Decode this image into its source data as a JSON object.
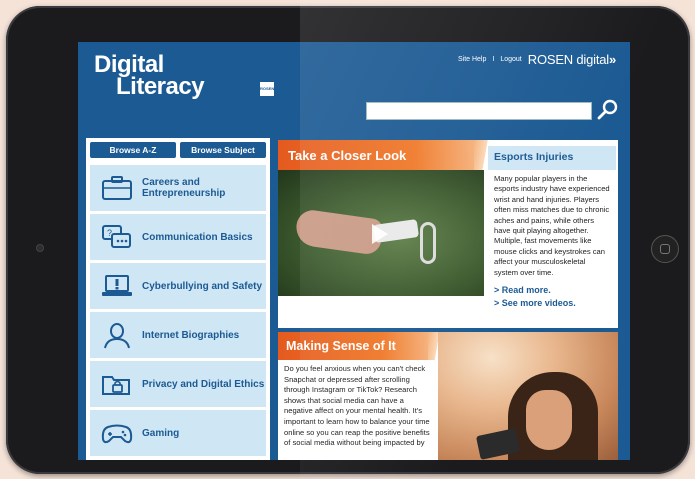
{
  "header": {
    "logo_line1": "Digital",
    "logo_line2": "Literacy",
    "logo_mark": "ROSEN",
    "site_help": "Site Help",
    "separator": "I",
    "logout": "Logout",
    "brand": "ROSEN digital",
    "brand_arrows": "»",
    "search_value": ""
  },
  "browse": {
    "tab_az": "Browse A-Z",
    "tab_subject": "Browse Subject"
  },
  "categories": [
    {
      "label": "Careers and Entrepreneurship",
      "icon": "briefcase-icon"
    },
    {
      "label": "Communication Basics",
      "icon": "chat-bubbles-icon"
    },
    {
      "label": "Cyberbullying and Safety",
      "icon": "laptop-warning-icon"
    },
    {
      "label": "Internet Biographies",
      "icon": "person-icon"
    },
    {
      "label": "Privacy and Digital Ethics",
      "icon": "folder-lock-icon"
    },
    {
      "label": "Gaming",
      "icon": "game-controller-icon"
    }
  ],
  "closer_look": {
    "title": "Take a Closer Look",
    "sidebar_title": "Esports Injuries",
    "sidebar_text": "Many popular players in the esports industry have experienced wrist and hand injuries. Players often miss matches due to chronic aches and pains, while others have quit playing altogether. Multiple, fast movements like mouse clicks and keystrokes can affect your musculoskeletal system over time.",
    "read_more": "> Read more.",
    "see_more": "> See more videos."
  },
  "making_sense": {
    "title": "Making Sense of It",
    "text": "Do you feel anxious when you can't check Snapchat or depressed after scrolling through Instagram or TikTok? Research shows that social media can have a negative affect on your mental health. It's important to learn how to balance your time online so you can reap the positive benefits of social media without being impacted by"
  },
  "colors": {
    "primary": "#1c5a93",
    "accent_orange": "#e45a1f",
    "light_blue": "#cfe6f5"
  }
}
